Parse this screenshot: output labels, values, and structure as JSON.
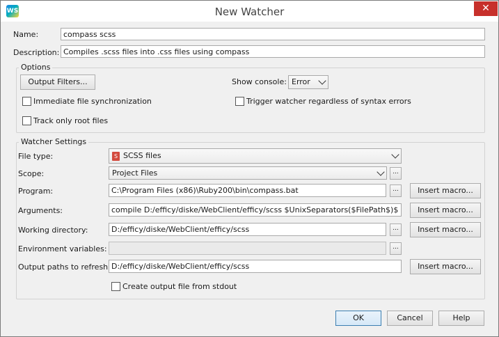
{
  "window": {
    "title": "New Watcher",
    "close_glyph": "✕",
    "app_icon_text": "WS"
  },
  "name_row": {
    "label": "Name:",
    "value": "compass scss"
  },
  "description_row": {
    "label": "Description:",
    "value": "Compiles .scss files into .css files using compass"
  },
  "options": {
    "title": "Options",
    "output_filters_label": "Output Filters...",
    "show_console_label": "Show console:",
    "show_console_value": "Error",
    "immediate_sync_label": "Immediate file synchronization",
    "trigger_watcher_label": "Trigger watcher regardless of syntax errors",
    "track_root_label": "Track only root files"
  },
  "watcher": {
    "title": "Watcher Settings",
    "file_type_label": "File type:",
    "file_type_value": "SCSS files",
    "file_type_icon": "S",
    "scope_label": "Scope:",
    "scope_value": "Project Files",
    "program_label": "Program:",
    "program_value": "C:\\Program Files (x86)\\Ruby200\\bin\\compass.bat",
    "arguments_label": "Arguments:",
    "arguments_value": "compile D:/efficy/diske/WebClient/efficy/scss $UnixSeparators($FilePath$)$",
    "working_dir_label": "Working directory:",
    "working_dir_value": "D:/efficy/diske/WebClient/efficy/scss",
    "env_label": "Environment variables:",
    "env_value": "",
    "output_paths_label": "Output paths to refresh:",
    "output_paths_value": "D:/efficy/diske/WebClient/efficy/scss",
    "stdout_label": "Create output file from stdout",
    "browse_label": "...",
    "insert_macro_label": "Insert macro..."
  },
  "footer": {
    "ok_label": "OK",
    "cancel_label": "Cancel",
    "help_label": "Help"
  }
}
